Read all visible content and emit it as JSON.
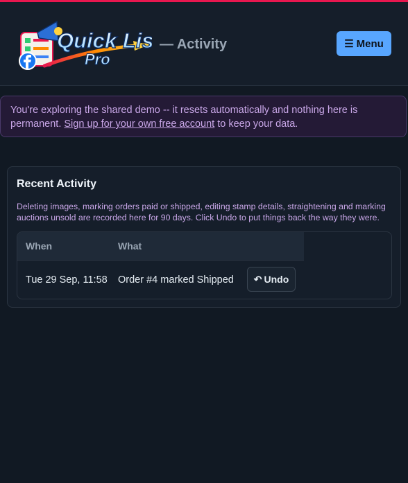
{
  "app": {
    "logo_text": "Quick List Pro",
    "logo_line1": "Quick List",
    "logo_line2": "Pro",
    "page_subtitle": "— Activity",
    "menu_icon": "☰",
    "menu_label": "Menu"
  },
  "banner": {
    "text_before": "You're exploring the shared demo -- it resets automatically and nothing here is permanent.",
    "link_text": "Sign up for your own free account",
    "text_after": "to keep your data."
  },
  "activity": {
    "title": "Recent Activity",
    "description": "Deleting images, marking orders paid or shipped, editing stamp details, straightening and marking auctions unsold are recorded here for 90 days. Click Undo to put things back the way they were.",
    "columns": [
      "When",
      "What"
    ],
    "rows": [
      {
        "when": "Tue 29 Sep, 11:58",
        "what": "Order #4 marked Shipped",
        "action_icon": "↶",
        "action_label": "Undo"
      }
    ]
  },
  "colors": {
    "accent": "#58a6ff",
    "stripe": "#e8174f",
    "banner_text": "#c9a7e8"
  }
}
